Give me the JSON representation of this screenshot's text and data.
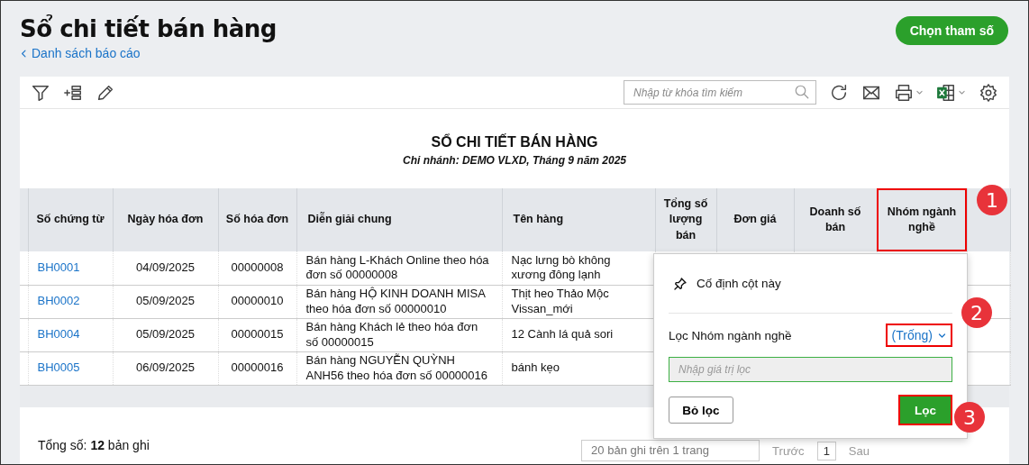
{
  "page": {
    "title": "Sổ chi tiết bán hàng",
    "back_link": "Danh sách báo cáo",
    "primary_button": "Chọn tham số"
  },
  "toolbar": {
    "search": {
      "placeholder": "Nhập từ khóa tìm kiếm"
    }
  },
  "report": {
    "title": "SỔ CHI TIẾT BÁN HÀNG",
    "subtitle": "Chi nhánh: DEMO VLXD, Tháng 9 năm 2025"
  },
  "table": {
    "columns": [
      {
        "label": "Số chứng từ",
        "highlighted": false
      },
      {
        "label": "Ngày hóa đơn",
        "highlighted": false
      },
      {
        "label": "Số hóa đơn",
        "highlighted": false
      },
      {
        "label": "Diễn giải chung",
        "highlighted": false
      },
      {
        "label": "Tên hàng",
        "highlighted": false
      },
      {
        "label": "Tổng số lượng bán",
        "highlighted": false
      },
      {
        "label": "Đơn giá",
        "highlighted": false
      },
      {
        "label": "Doanh số bán",
        "highlighted": false
      },
      {
        "label": "Nhóm ngành nghề",
        "highlighted": true
      }
    ],
    "rows": [
      [
        "BH0001",
        "04/09/2025",
        "00000008",
        "Bán hàng L-Khách Online theo hóa đơn số 00000008",
        "Nạc lưng bò không xương đông lạnh"
      ],
      [
        "BH0002",
        "05/09/2025",
        "00000010",
        "Bán hàng HỘ KINH DOANH MISA theo hóa đơn số 00000010",
        "Thịt heo Thảo Mộc Vissan_mới"
      ],
      [
        "BH0004",
        "05/09/2025",
        "00000015",
        "Bán hàng Khách lẻ theo hóa đơn số 00000015",
        "12 Cành lá quả sori"
      ],
      [
        "BH0005",
        "06/09/2025",
        "00000016",
        "Bán hàng NGUYỄN QUỲNH ANH56 theo hóa đơn số 00000016",
        "bánh kẹo"
      ]
    ]
  },
  "footer": {
    "total": "Tổng số: **12** bản ghi",
    "page_size": "20 bản ghi trên 1 trang",
    "prev": "Trước",
    "page": "1",
    "next": "Sau"
  },
  "column_menu": {
    "pin": "Cố định cột này",
    "filter_label": "Lọc Nhóm ngành nghề",
    "filter_value": "(Trống)",
    "filter_value_highlighted": true,
    "input_placeholder": "Nhập giá trị lọc",
    "clear_button": "Bỏ lọc",
    "apply_button": "Lọc",
    "apply_highlighted": true
  },
  "annotations": [
    {
      "label": "1"
    },
    {
      "label": "2"
    },
    {
      "label": "3"
    }
  ]
}
